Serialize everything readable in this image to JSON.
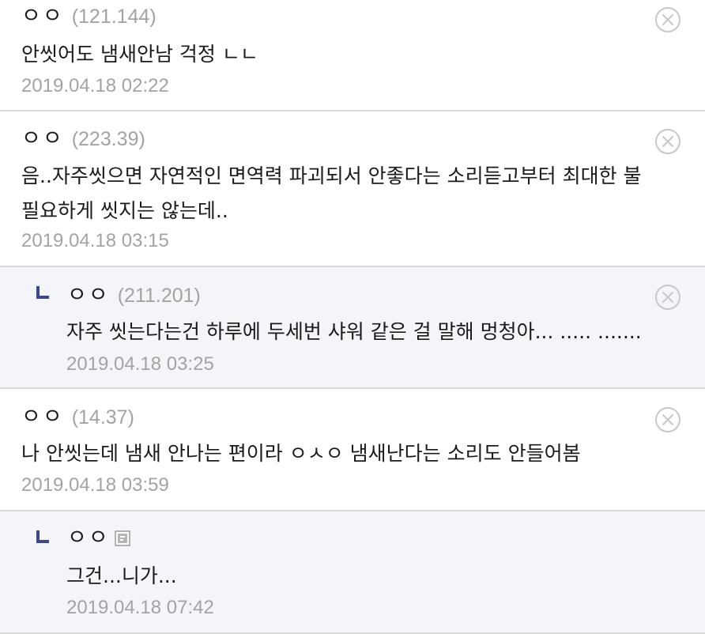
{
  "comments": [
    {
      "nickname": "ㅇㅇ",
      "ip": "(121.144)",
      "text": "안씻어도 냄새안남 걱정 ㄴㄴ",
      "date": "2019.04.18 02:22"
    },
    {
      "nickname": "ㅇㅇ",
      "ip": "(223.39)",
      "text_line1": "음..자주씻으면 자연적인 면역력 파괴되서 안좋다는 소리듣고부터 최대한 불",
      "text_line2": "필요하게 씻지는 않는데..",
      "date": "2019.04.18 03:15"
    },
    {
      "nickname": "ㅇㅇ",
      "ip": "(211.201)",
      "text": "자주 씻는다는건 하루에 두세번 샤워 같은 걸 말해 멍청아... ..... .......",
      "date": "2019.04.18 03:25"
    },
    {
      "nickname": "ㅇㅇ",
      "ip": "(14.37)",
      "text": "나 안씻는데 냄새 안나는 편이라 ㅇㅅㅇ 냄새난다는 소리도 안들어봄",
      "date": "2019.04.18 03:59"
    },
    {
      "nickname": "ㅇㅇ",
      "text": "그건...니가...",
      "date": "2019.04.18 07:42"
    }
  ],
  "icons": {
    "delete": "close-circle-icon",
    "reply": "reply-arrow-icon",
    "member": "gallog-icon"
  },
  "colors": {
    "reply_marker": "#3b4890",
    "muted_text": "#a3a3a3",
    "reply_background": "#f4f5f9",
    "divider": "#d9d9d9"
  }
}
